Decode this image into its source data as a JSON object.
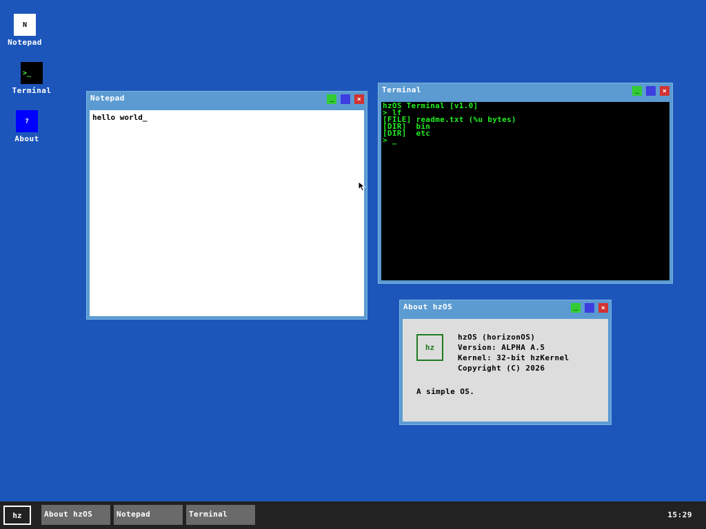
{
  "desktop": {
    "icons": [
      {
        "glyph": "N",
        "label": "Notepad"
      },
      {
        "glyph": ">_",
        "label": "Terminal"
      },
      {
        "glyph": "?",
        "label": "About"
      }
    ]
  },
  "windows": {
    "notepad": {
      "title": "Notepad",
      "text": "hello world_"
    },
    "terminal": {
      "title": "Terminal",
      "lines": [
        "hzOS Terminal [v1.0]",
        "> lf",
        "[FILE] readme.txt (%u bytes)",
        "[DIR]  bin",
        "[DIR]  etc",
        "> _"
      ]
    },
    "about": {
      "title": "About hzOS",
      "logo": "hz",
      "lines": [
        "hzOS (horizonOS)",
        "Version: ALPHA A.5",
        "Kernel: 32-bit hzKernel",
        "Copyright (C) 2026"
      ],
      "description": "A simple OS."
    }
  },
  "window_buttons": {
    "close": "×"
  },
  "taskbar": {
    "start_label": "hz",
    "items": [
      "About hzOS",
      "Notepad",
      "Terminal"
    ],
    "clock": "15:29"
  },
  "colors": {
    "desktop": "#1d56ba",
    "window_frame": "#5b9bd2",
    "terminal_text": "#22ee22",
    "taskbar": "#222222"
  }
}
